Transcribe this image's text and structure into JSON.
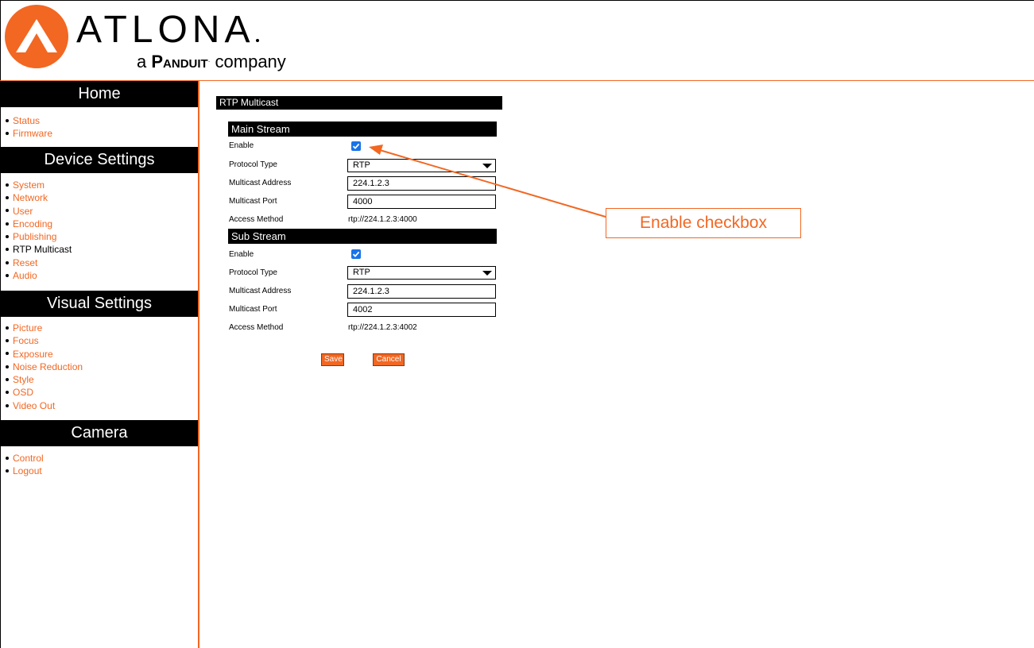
{
  "brand": {
    "logo_text": "ATLONA",
    "tagline_prefix": "a",
    "tagline_brand": "Panduit",
    "tagline_suffix": "company",
    "accent_color": "#f26722"
  },
  "sidebar": {
    "sections": [
      {
        "title": "Home",
        "items": [
          "Status",
          "Firmware"
        ]
      },
      {
        "title": "Device Settings",
        "items": [
          "System",
          "Network",
          "User",
          "Encoding",
          "Publishing",
          "RTP Multicast",
          "Reset",
          "Audio"
        ]
      },
      {
        "title": "Visual Settings",
        "items": [
          "Picture",
          "Focus",
          "Exposure",
          "Noise Reduction",
          "Style",
          "OSD",
          "Video Out"
        ]
      },
      {
        "title": "Camera",
        "items": [
          "Control",
          "Logout"
        ]
      }
    ],
    "current_item": "RTP Multicast"
  },
  "page": {
    "title": "RTP Multicast",
    "main_stream": {
      "heading": "Main Stream",
      "enable_label": "Enable",
      "enable_checked": true,
      "protocol_label": "Protocol Type",
      "protocol_value": "RTP",
      "address_label": "Multicast Address",
      "address_value": "224.1.2.3",
      "port_label": "Multicast Port",
      "port_value": "4000",
      "access_label": "Access Method",
      "access_value": "rtp://224.1.2.3:4000"
    },
    "sub_stream": {
      "heading": "Sub Stream",
      "enable_label": "Enable",
      "enable_checked": true,
      "protocol_label": "Protocol Type",
      "protocol_value": "RTP",
      "address_label": "Multicast Address",
      "address_value": "224.1.2.3",
      "port_label": "Multicast Port",
      "port_value": "4002",
      "access_label": "Access Method",
      "access_value": "rtp://224.1.2.3:4002"
    },
    "save_label": "Save",
    "cancel_label": "Cancel"
  },
  "annotation": {
    "callout_text": "Enable checkbox"
  }
}
